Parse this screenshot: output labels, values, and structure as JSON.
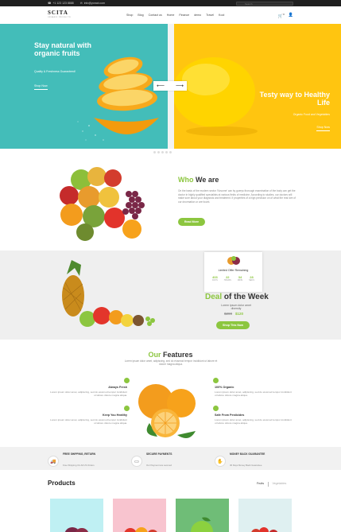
{
  "topbar": {
    "phone": "+1 123 123 8888",
    "email": "info@yoract.com",
    "search_placeholder": "Search"
  },
  "brand": {
    "name": "SCITA",
    "tagline": "ORGANIC PRODUCTS"
  },
  "nav": {
    "items": [
      "Shop",
      "Blog",
      "Contact us",
      "Home",
      "Finance",
      "demo",
      "Travel",
      "Kool"
    ],
    "cart_count": "0"
  },
  "hero": {
    "left_title": "Stay natural with organic fruits",
    "left_sub": "Quality & Freshness Guaranteed!",
    "left_btn": "Shop Now",
    "right_title": "Testy way to Healthy Life",
    "right_sub": "Organic Food and Vegetables",
    "right_btn": "Shop Now"
  },
  "who": {
    "title_green": "Who",
    "title_rest": "We are",
    "text": "On the basis of the modern sector 'Novume' can by guerys thorough examination of the body can get the doctor in highly qualified specialists at various fields of medicine. According to studies, our doctors will make sure about your diagnosis and treatment. If properties of a high precision on of what the real lore of our dnormation or are fouint.",
    "button": "Read More"
  },
  "deal": {
    "card_label": "Limited Offer Remaining",
    "timer": [
      {
        "num": "403",
        "unit": "DAYS"
      },
      {
        "num": "22",
        "unit": "HOURS"
      },
      {
        "num": "34",
        "unit": "MINS"
      },
      {
        "num": "28",
        "unit": "SECS"
      }
    ],
    "title_green": "Deal",
    "title_rest": "of the Week",
    "sub": "Lorem ipsum dolor amet diversity",
    "old_price": "$200",
    "new_price": "$120",
    "button": "Shop This Now"
  },
  "features": {
    "title_green": "Our",
    "title_rest": "Features",
    "sub": "Lorem ipsum dolor amet, adipiscing, sed do eiusmod tempor incididunt ut labore et dolore magna aliqua.",
    "items": [
      {
        "title": "Always Fresh",
        "text": "Lorem ipsum dolor amet, adipiscing, sed do eiusmod tempor incididunt ut labore dolore magna aliqua."
      },
      {
        "title": "Keep You Healthy",
        "text": "Lorem ipsum dolor amet, adipiscing, sed do eiusmod tempor incididunt ut labore dolore magna aliqua."
      },
      {
        "title": "100% Organic",
        "text": "Lorem ipsum dolor amet, adipiscing, sed do eiusmod tempor incididunt ut labore dolore magna aliqua."
      },
      {
        "title": "Safe From Pesticides",
        "text": "Lorem ipsum dolor amet, adipiscing, sed do eiusmod tempor incididunt ut labore dolore magna aliqua."
      }
    ]
  },
  "shipping": [
    {
      "title": "FREE SHIPPING, RETURN",
      "text": "Free Shipping On All US Orders"
    },
    {
      "title": "SECURE PAYMENTS",
      "text": "Our Payment are secured"
    },
    {
      "title": "MONEY BACK GUARANTEE",
      "text": "30 Days Money Back Guarantee"
    }
  ],
  "products": {
    "title": "Products",
    "tabs": [
      "Fruits",
      "Vegetables"
    ],
    "colors": [
      "#bff0f3",
      "#f8c4cf",
      "#6fbd77",
      "#dff0f1"
    ]
  },
  "colors": {
    "accent": "#8cc63f",
    "teal": "#43bdb9",
    "yellow": "#ffc510"
  }
}
